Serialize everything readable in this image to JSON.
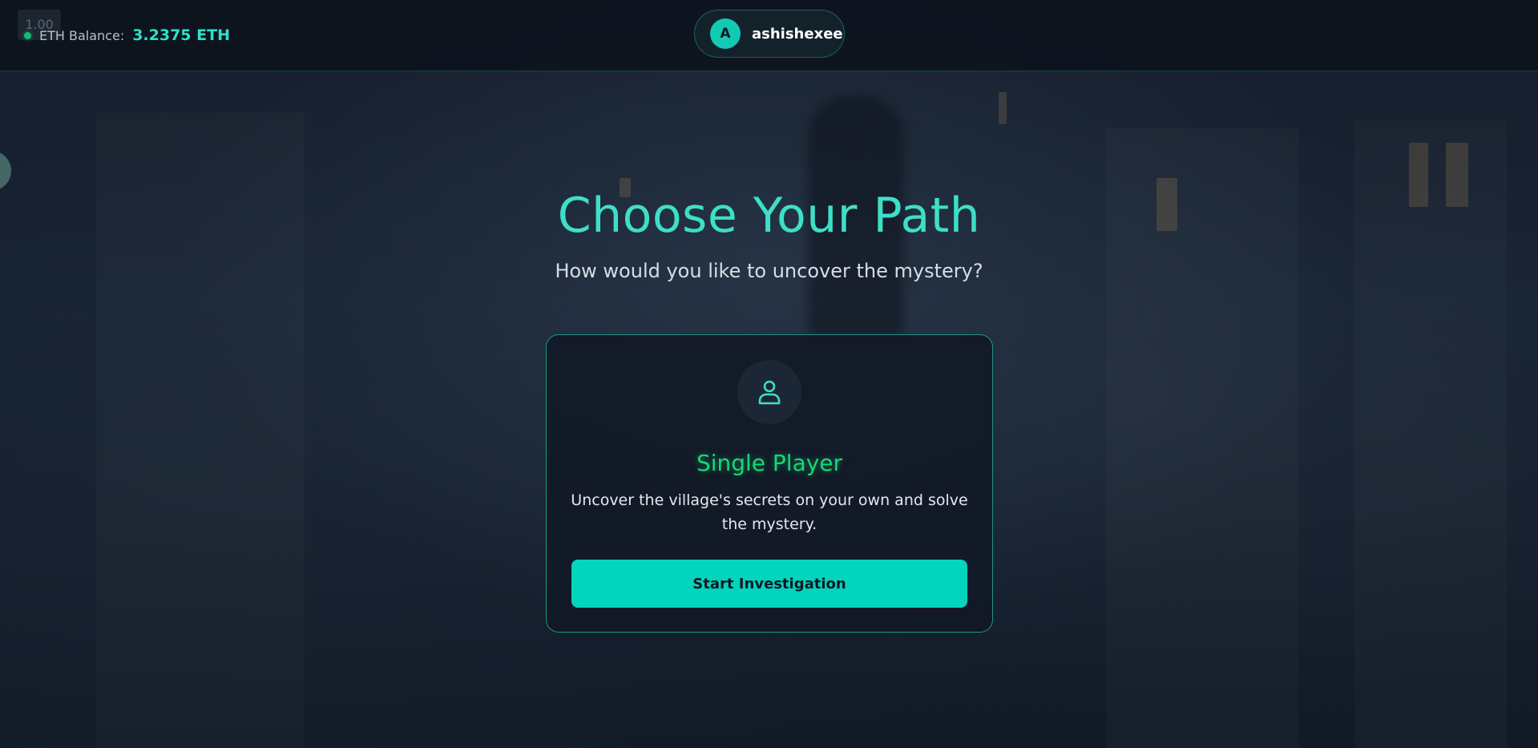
{
  "header": {
    "fps": "1.00",
    "balance_label": "ETH Balance:",
    "balance_value": "3.2375 ETH",
    "user": {
      "avatar_letter": "A",
      "username": "ashishexee"
    }
  },
  "main": {
    "title": "Choose Your Path",
    "subtitle": "How would you like to uncover the mystery?",
    "card": {
      "icon": "user-icon",
      "title": "Single Player",
      "description": "Uncover the village's secrets on your own and solve the mystery.",
      "button_label": "Start Investigation"
    }
  },
  "colors": {
    "accent": "#3ddfc7",
    "button": "#03d4bd",
    "single_player": "#16d877",
    "status_dot": "#17b978"
  }
}
